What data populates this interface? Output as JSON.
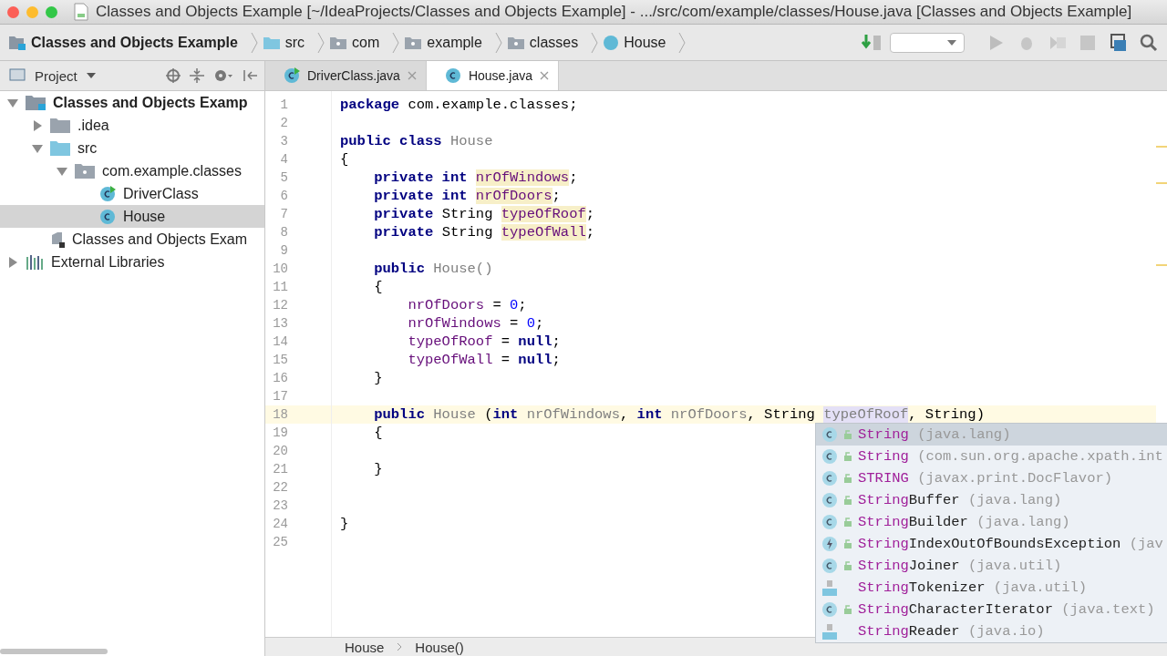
{
  "window": {
    "title": "Classes and Objects Example [~/IdeaProjects/Classes and Objects Example] - .../src/com/example/classes/House.java [Classes and Objects Example]"
  },
  "navigation_bar": [
    {
      "label": "Classes and Objects Example",
      "kind": "project"
    },
    {
      "label": "src",
      "kind": "source"
    },
    {
      "label": "com",
      "kind": "package"
    },
    {
      "label": "example",
      "kind": "package"
    },
    {
      "label": "classes",
      "kind": "package"
    },
    {
      "label": "House",
      "kind": "class"
    }
  ],
  "project_panel": {
    "title": "Project",
    "tree": [
      {
        "label": "Classes and Objects Examp",
        "kind": "project",
        "expanded": true,
        "selected": false,
        "children": [
          {
            "label": ".idea",
            "kind": "folder",
            "expanded": false,
            "selected": false
          },
          {
            "label": "src",
            "kind": "source",
            "expanded": true,
            "selected": false,
            "children": [
              {
                "label": "com.example.classes",
                "kind": "package",
                "expanded": true,
                "selected": false,
                "children": [
                  {
                    "label": "DriverClass",
                    "kind": "runclass",
                    "selected": false
                  },
                  {
                    "label": "House",
                    "kind": "class",
                    "selected": true
                  }
                ]
              }
            ]
          },
          {
            "label": "Classes and Objects Exam",
            "kind": "iml",
            "selected": false
          }
        ]
      },
      {
        "label": "External Libraries",
        "kind": "library",
        "expanded": false,
        "selected": false
      }
    ]
  },
  "tabs": [
    {
      "label": "DriverClass.java",
      "kind": "runclass",
      "selected": false
    },
    {
      "label": "House.java",
      "kind": "class",
      "selected": true
    }
  ],
  "editor": {
    "lines": [
      {
        "number": "1",
        "current": false,
        "tokens": [
          {
            "t": "package",
            "kind": "kw"
          },
          {
            "t": " com.example.classes;",
            "kind": "text"
          }
        ]
      },
      {
        "number": "2",
        "current": false
      },
      {
        "number": "3",
        "current": false,
        "tokens": [
          {
            "t": "public class",
            "kind": "kw"
          },
          {
            "t": " House",
            "kind": "unused"
          }
        ]
      },
      {
        "number": "4",
        "current": false,
        "tokens": [
          {
            "t": "{",
            "kind": "text"
          }
        ]
      },
      {
        "number": "5",
        "current": false,
        "tokens": [
          {
            "t": "    private int ",
            "kind": "kw"
          },
          {
            "t": "nrOfWindows",
            "kind": "field"
          },
          {
            "t": ";",
            "kind": "text"
          }
        ]
      },
      {
        "number": "6",
        "current": false,
        "tokens": [
          {
            "t": "    private int ",
            "kind": "kw"
          },
          {
            "t": "nrOfDoors",
            "kind": "field"
          },
          {
            "t": ";",
            "kind": "text"
          }
        ]
      },
      {
        "number": "7",
        "current": false,
        "tokens": [
          {
            "t": "    private",
            "kind": "kw"
          },
          {
            "t": " String ",
            "kind": "text"
          },
          {
            "t": "typeOfRoof",
            "kind": "field"
          },
          {
            "t": ";",
            "kind": "text"
          }
        ]
      },
      {
        "number": "8",
        "current": false,
        "tokens": [
          {
            "t": "    private",
            "kind": "kw"
          },
          {
            "t": " String ",
            "kind": "text"
          },
          {
            "t": "typeOfWall",
            "kind": "field"
          },
          {
            "t": ";",
            "kind": "text"
          }
        ]
      },
      {
        "number": "9",
        "current": false
      },
      {
        "number": "10",
        "current": false,
        "tokens": [
          {
            "t": "    public",
            "kind": "kw"
          },
          {
            "t": " House()",
            "kind": "unused"
          }
        ]
      },
      {
        "number": "11",
        "current": false,
        "tokens": [
          {
            "t": "    {",
            "kind": "text"
          }
        ]
      },
      {
        "number": "12",
        "current": false,
        "tokens": [
          {
            "t": "        nrOfDoors",
            "kind": "var"
          },
          {
            "t": " = ",
            "kind": "text"
          },
          {
            "t": "0",
            "kind": "num"
          },
          {
            "t": ";",
            "kind": "text"
          }
        ]
      },
      {
        "number": "13",
        "current": false,
        "tokens": [
          {
            "t": "        nrOfWindows",
            "kind": "var"
          },
          {
            "t": " = ",
            "kind": "text"
          },
          {
            "t": "0",
            "kind": "num"
          },
          {
            "t": ";",
            "kind": "text"
          }
        ]
      },
      {
        "number": "14",
        "current": false,
        "tokens": [
          {
            "t": "        typeOfRoof",
            "kind": "var"
          },
          {
            "t": " = ",
            "kind": "text"
          },
          {
            "t": "null",
            "kind": "kw"
          },
          {
            "t": ";",
            "kind": "text"
          }
        ]
      },
      {
        "number": "15",
        "current": false,
        "tokens": [
          {
            "t": "        typeOfWall",
            "kind": "var"
          },
          {
            "t": " = ",
            "kind": "text"
          },
          {
            "t": "null",
            "kind": "kw"
          },
          {
            "t": ";",
            "kind": "text"
          }
        ]
      },
      {
        "number": "16",
        "current": false,
        "tokens": [
          {
            "t": "    }",
            "kind": "text"
          }
        ]
      },
      {
        "number": "17",
        "current": false
      },
      {
        "number": "18",
        "current": true,
        "tokens": [
          {
            "t": "    public",
            "kind": "kw"
          },
          {
            "t": " House",
            "kind": "unused"
          },
          {
            "t": " (",
            "kind": "text"
          },
          {
            "t": "int",
            "kind": "kw"
          },
          {
            "t": " nrOfWindows",
            "kind": "unused"
          },
          {
            "t": ", ",
            "kind": "text"
          },
          {
            "t": "int",
            "kind": "kw"
          },
          {
            "t": " nrOfDoors",
            "kind": "unused"
          },
          {
            "t": ", String ",
            "kind": "text"
          },
          {
            "t": "typeOfRoof",
            "kind": "unused_selected"
          },
          {
            "t": ", String)",
            "kind": "text"
          }
        ]
      },
      {
        "number": "19",
        "current": false,
        "tokens": [
          {
            "t": "    {",
            "kind": "text"
          }
        ]
      },
      {
        "number": "20",
        "current": false
      },
      {
        "number": "21",
        "current": false,
        "tokens": [
          {
            "t": "    }",
            "kind": "text"
          }
        ]
      },
      {
        "number": "22",
        "current": false
      },
      {
        "number": "23",
        "current": false
      },
      {
        "number": "24",
        "current": false,
        "tokens": [
          {
            "t": "}",
            "kind": "text"
          }
        ]
      },
      {
        "number": "25",
        "current": false
      }
    ]
  },
  "completion": [
    {
      "kind": "class",
      "match": "String",
      "package": "(java.lang)",
      "selected": true
    },
    {
      "kind": "class",
      "match": "String",
      "package": "(com.sun.org.apache.xpath.int",
      "selected": false
    },
    {
      "kind": "field",
      "match": "STRING",
      "package": "(javax.print.DocFlavor)",
      "selected": false
    },
    {
      "kind": "class",
      "match": "String",
      "rest": "Buffer",
      "package": "(java.lang)",
      "selected": false
    },
    {
      "kind": "class",
      "match": "String",
      "rest": "Builder",
      "package": "(java.lang)",
      "selected": false
    },
    {
      "kind": "exception",
      "match": "String",
      "rest": "IndexOutOfBoundsException",
      "package": "(jav",
      "selected": false
    },
    {
      "kind": "class",
      "match": "String",
      "rest": "Joiner",
      "package": "(java.util)",
      "selected": false
    },
    {
      "kind": "binary",
      "match": "String",
      "rest": "Tokenizer",
      "package": "(java.util)",
      "selected": false
    },
    {
      "kind": "class",
      "match": "String",
      "rest": "CharacterIterator",
      "package": "(java.text)",
      "selected": false
    },
    {
      "kind": "binary",
      "match": "String",
      "rest": "Reader",
      "package": "(java.io)",
      "selected": false
    }
  ],
  "breadcrumbs": [
    "House",
    "House()"
  ]
}
